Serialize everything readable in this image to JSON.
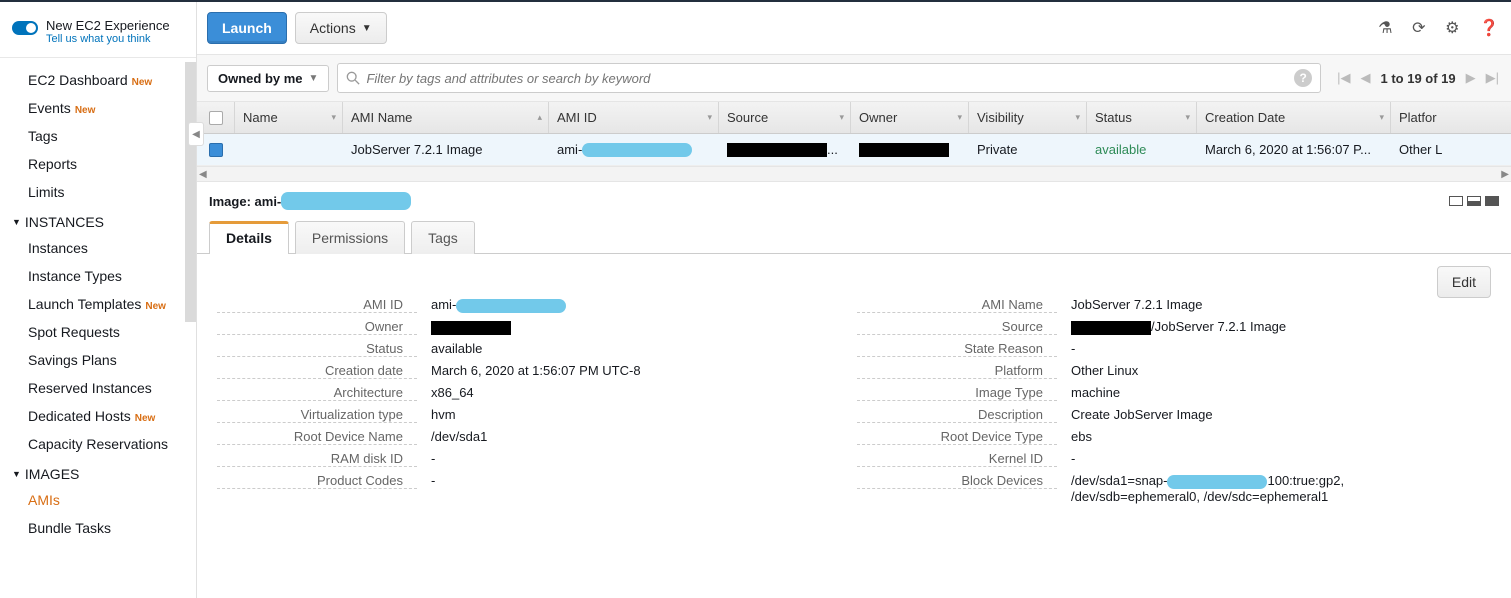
{
  "sidebar": {
    "experience_title": "New EC2 Experience",
    "experience_sub": "Tell us what you think",
    "top_items": [
      {
        "label": "EC2 Dashboard",
        "new": true
      },
      {
        "label": "Events",
        "new": true
      },
      {
        "label": "Tags",
        "new": false
      },
      {
        "label": "Reports",
        "new": false
      },
      {
        "label": "Limits",
        "new": false
      }
    ],
    "sections": [
      {
        "title": "INSTANCES",
        "items": [
          {
            "label": "Instances",
            "new": false
          },
          {
            "label": "Instance Types",
            "new": false
          },
          {
            "label": "Launch Templates",
            "new": true
          },
          {
            "label": "Spot Requests",
            "new": false
          },
          {
            "label": "Savings Plans",
            "new": false
          },
          {
            "label": "Reserved Instances",
            "new": false
          },
          {
            "label": "Dedicated Hosts",
            "new": true
          },
          {
            "label": "Capacity Reservations",
            "new": false
          }
        ]
      },
      {
        "title": "IMAGES",
        "items": [
          {
            "label": "AMIs",
            "new": false,
            "active": true
          },
          {
            "label": "Bundle Tasks",
            "new": false
          }
        ]
      }
    ],
    "badge_new": "New"
  },
  "toolbar": {
    "launch": "Launch",
    "actions": "Actions"
  },
  "filter": {
    "owned": "Owned by me",
    "placeholder": "Filter by tags and attributes or search by keyword",
    "pager": "1 to 19 of 19"
  },
  "table": {
    "headers": [
      "Name",
      "AMI Name",
      "AMI ID",
      "Source",
      "Owner",
      "Visibility",
      "Status",
      "Creation Date",
      "Platfor"
    ],
    "row": {
      "ami_name": "JobServer 7.2.1 Image",
      "ami_id_prefix": "ami-",
      "visibility": "Private",
      "status": "available",
      "creation": "March 6, 2020 at 1:56:07 P...",
      "platform": "Other L"
    }
  },
  "detail_header": {
    "label": "Image:",
    "ami_prefix": "ami-"
  },
  "tabs": {
    "details": "Details",
    "permissions": "Permissions",
    "tags": "Tags"
  },
  "edit": "Edit",
  "details_left": [
    {
      "k": "AMI ID",
      "v_prefix": "ami-",
      "redact": true
    },
    {
      "k": "Owner",
      "v": "",
      "black": true
    },
    {
      "k": "Status",
      "v": "available"
    },
    {
      "k": "Creation date",
      "v": "March 6, 2020 at 1:56:07 PM UTC-8"
    },
    {
      "k": "Architecture",
      "v": "x86_64"
    },
    {
      "k": "Virtualization type",
      "v": "hvm"
    },
    {
      "k": "Root Device Name",
      "v": "/dev/sda1"
    },
    {
      "k": "RAM disk ID",
      "v": "-"
    },
    {
      "k": "Product Codes",
      "v": "-"
    }
  ],
  "details_right": [
    {
      "k": "AMI Name",
      "v": "JobServer 7.2.1 Image"
    },
    {
      "k": "Source",
      "v": "/JobServer 7.2.1 Image",
      "black_prefix": true
    },
    {
      "k": "State Reason",
      "v": "-"
    },
    {
      "k": "Platform",
      "v": "Other Linux"
    },
    {
      "k": "Image Type",
      "v": "machine"
    },
    {
      "k": "Description",
      "v": "Create JobServer Image"
    },
    {
      "k": "Root Device Type",
      "v": "ebs"
    },
    {
      "k": "Kernel ID",
      "v": "-"
    },
    {
      "k": "Block Devices",
      "v_prefix": "/dev/sda1=snap-",
      "v_suffix": "100:true:gp2,",
      "v_line2": "/dev/sdb=ephemeral0, /dev/sdc=ephemeral1",
      "redact": true
    }
  ]
}
